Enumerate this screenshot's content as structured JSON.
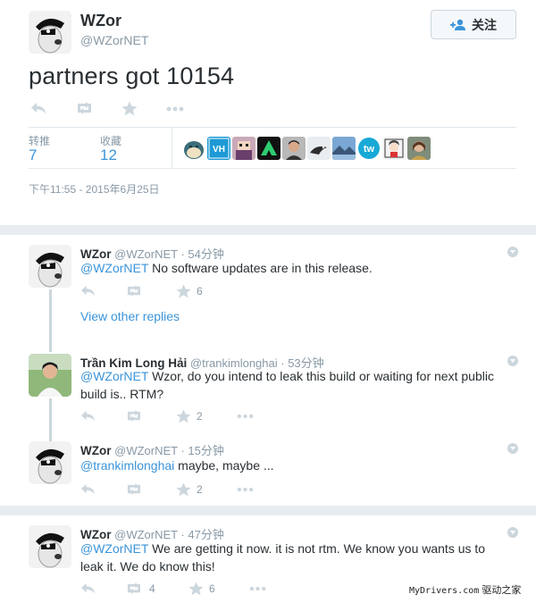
{
  "main": {
    "name": "WZor",
    "handle": "@WZorNET",
    "follow_label": "关注",
    "text": "partners got 10154",
    "retweets_label": "转推",
    "retweets_count": "7",
    "likes_label": "收藏",
    "likes_count": "12",
    "timestamp": "下午11:55 - 2015年6月25日",
    "liker_icons": [
      "snorlax-avatar",
      "vh-avatar",
      "pixel-avatar",
      "triangle-logo-avatar",
      "person-avatar",
      "bird-avatar",
      "landscape-avatar",
      "tw-logo-avatar",
      "anime-avatar",
      "portrait-avatar"
    ]
  },
  "thread": {
    "reply1": {
      "name": "WZor",
      "handle": "@WZorNET",
      "time": "· 54分钟",
      "mention": "@WZorNET",
      "text": " No software updates are in this release.",
      "likes": "6"
    },
    "view_other_replies": "View other replies",
    "reply2": {
      "name": "Trần Kim Long Hải",
      "handle": "@trankimlonghai",
      "time": "· 53分钟",
      "mention": "@WZorNET",
      "text": " Wzor, do you intend to leak this build or waiting for next public build is.. RTM?",
      "likes": "2"
    },
    "reply3": {
      "name": "WZor",
      "handle": "@WZorNET",
      "time": "· 15分钟",
      "mention": "@trankimlonghai",
      "text": " maybe, maybe ...",
      "likes": "2"
    }
  },
  "last": {
    "name": "WZor",
    "handle": "@WZorNET",
    "time": "· 47分钟",
    "mention": "@WZorNET",
    "text": "  We are getting it now. it is not rtm. We know you wants us to leak it. We do know this!",
    "retweets": "4",
    "likes": "6"
  },
  "watermark": {
    "site": "MyDrivers.com",
    "cn": "驱动之家"
  },
  "colors": {
    "link": "#3b94d9",
    "muted": "#8899a6",
    "icon": "#ccd6dd"
  }
}
